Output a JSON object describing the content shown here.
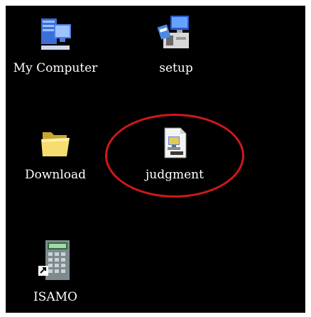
{
  "desktop": {
    "icons": [
      {
        "label": "My Computer",
        "icon": "my-computer-icon"
      },
      {
        "label": "setup",
        "icon": "setup-installer-icon"
      },
      {
        "label": "Download",
        "icon": "folder-icon"
      },
      {
        "label": "judgment",
        "icon": "document-shortcut-icon"
      },
      {
        "label": "ISAMO",
        "icon": "calculator-shortcut-icon"
      }
    ],
    "selected_icon": "judgment",
    "highlight_color": "#d01818",
    "background_color": "#000000"
  }
}
